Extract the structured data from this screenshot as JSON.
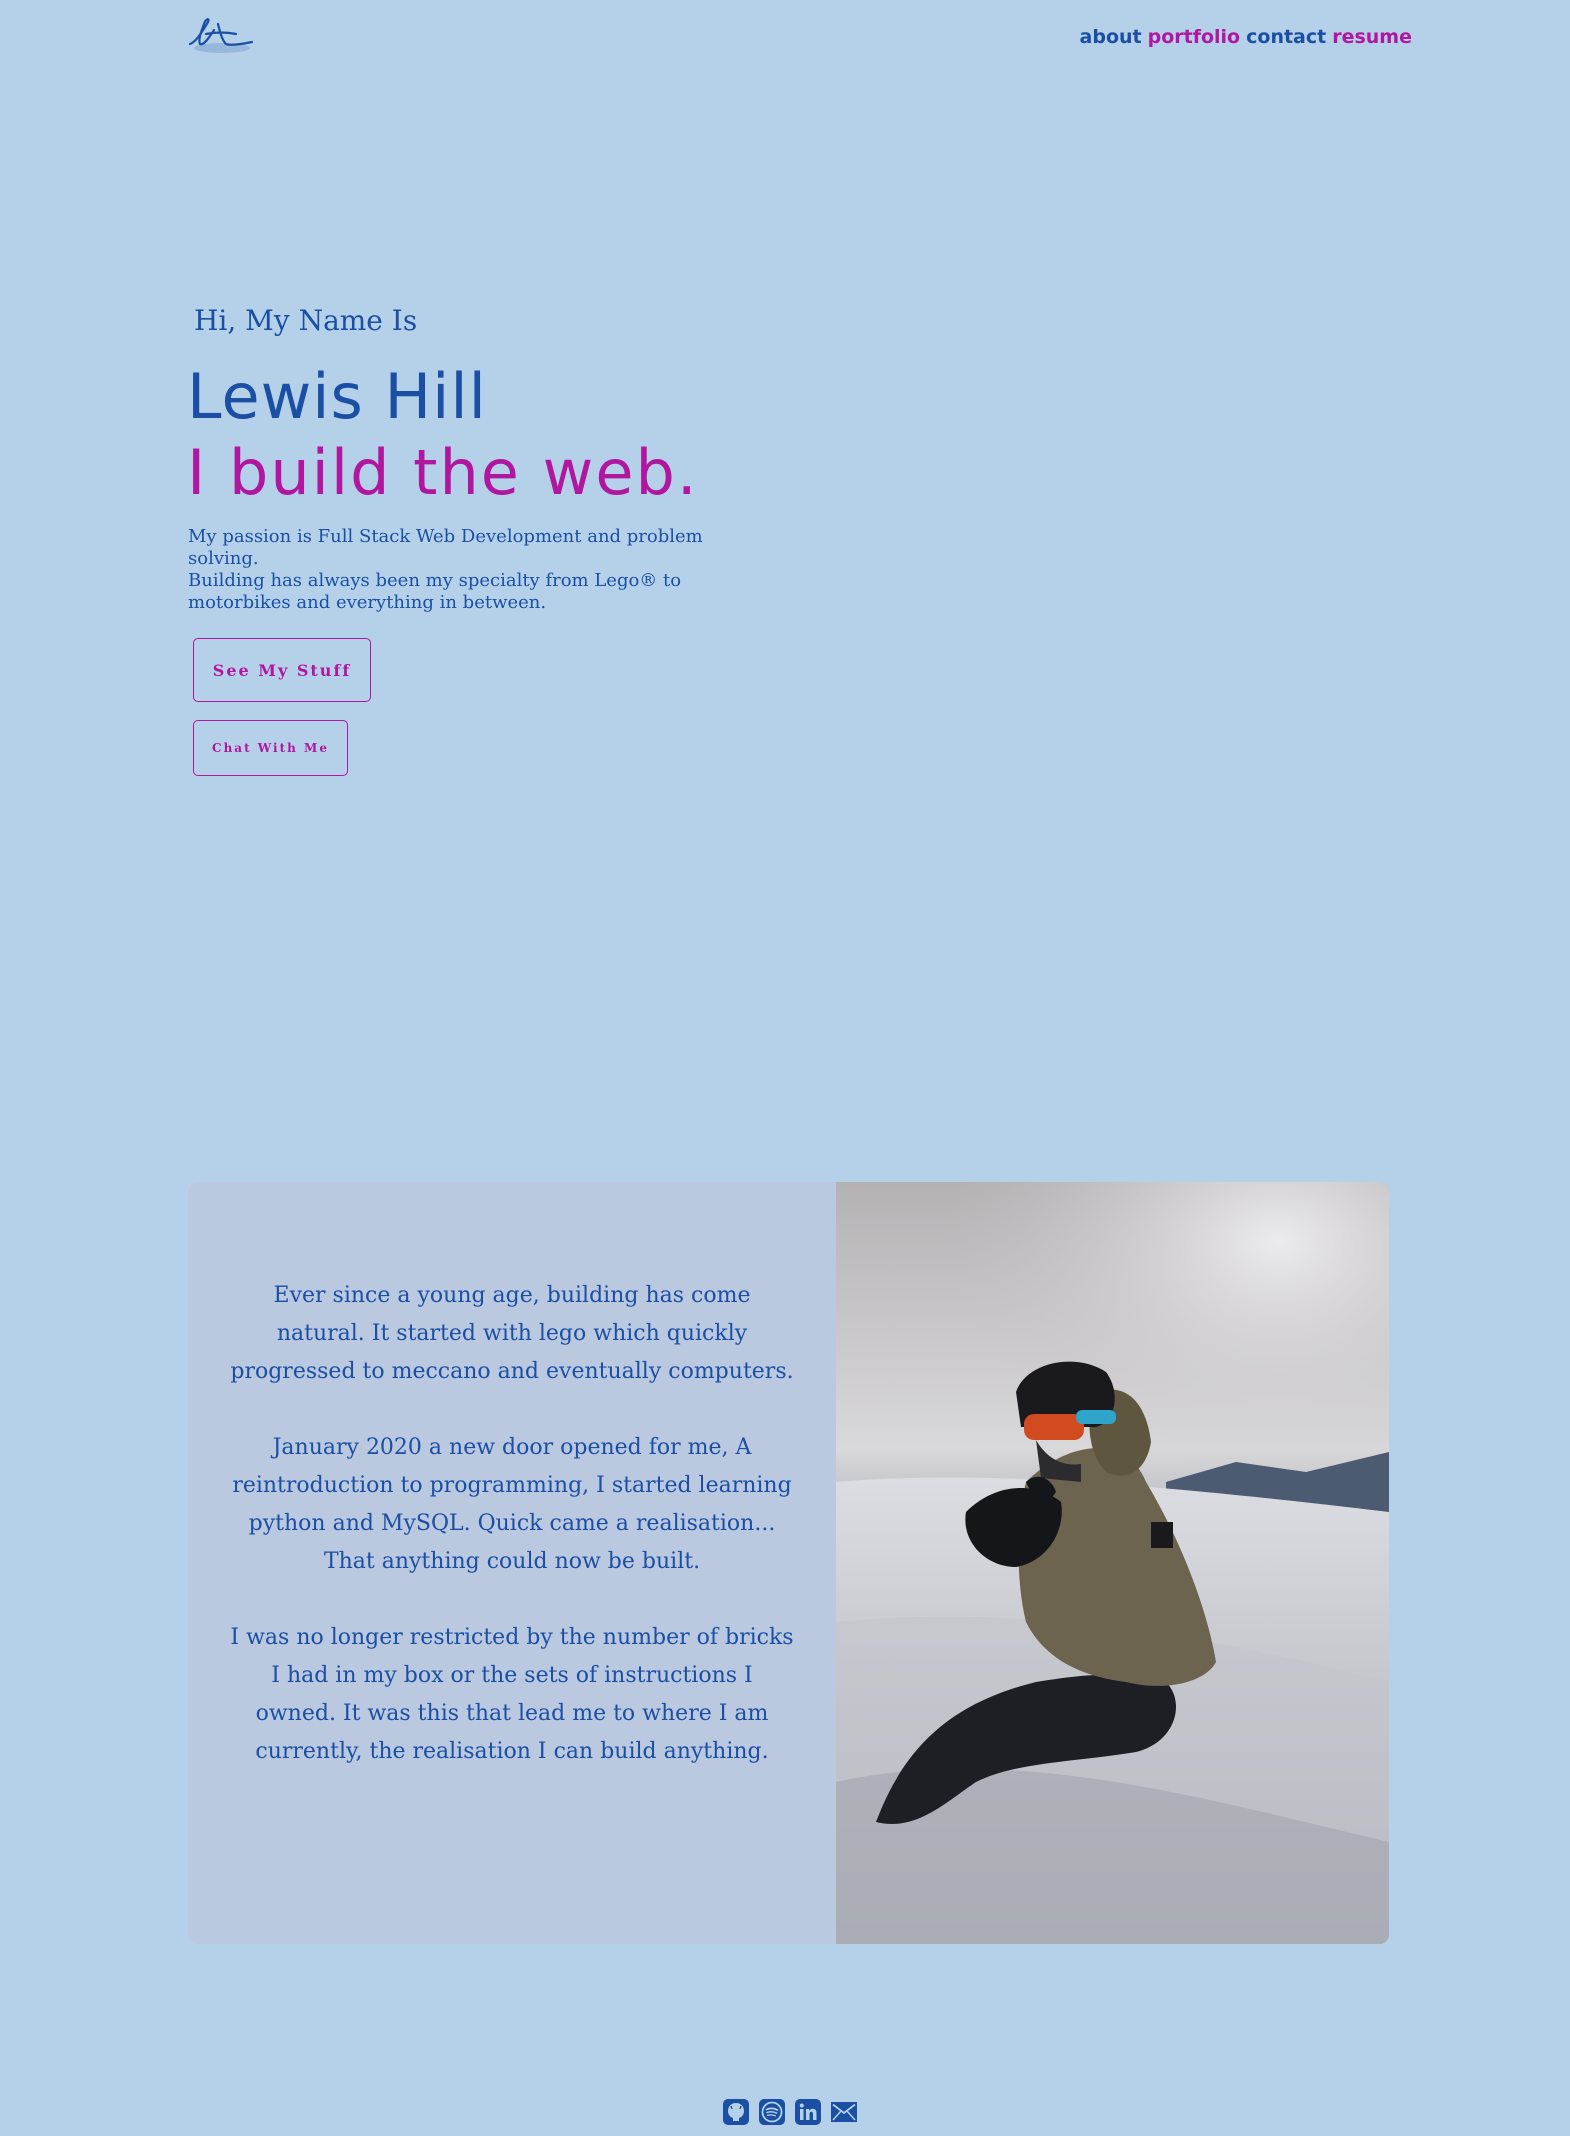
{
  "header": {
    "logo_icon": "signature-logo-icon",
    "nav": [
      {
        "label": "about",
        "color": "#1a4fa3"
      },
      {
        "label": "portfolio",
        "color": "#b0179e"
      },
      {
        "label": "contact",
        "color": "#1a4fa3"
      },
      {
        "label": "resume",
        "color": "#b0179e"
      }
    ]
  },
  "hero": {
    "greeting": "Hi, My Name Is",
    "name": "Lewis Hill",
    "tagline": "I build the web.",
    "intro_line1": "My passion is Full Stack Web Development and problem solving.",
    "intro_line2": "Building has always been my specialty from Lego® to motorbikes and everything in between.",
    "primary_button": "See My Stuff",
    "secondary_button": "Chat With Me"
  },
  "about": {
    "paragraphs": [
      "Ever since a young age, building has come natural. It started with lego which quickly progressed to meccano and eventually computers.",
      "January 2020 a new door opened for me, A reintroduction to programming, I started learning python and MySQL. Quick came a realisation... That anything could now be built.",
      "I was no longer restricted by the number of bricks I had in my box or the sets of instructions I owned. It was this that lead me to where I am currently, the realisation I can build anything."
    ],
    "photo_icon": "snowboarder-photo"
  },
  "footer": {
    "socials": [
      "github-icon",
      "spotify-icon",
      "linkedin-icon",
      "email-icon"
    ]
  },
  "colors": {
    "background": "#b5d1ea",
    "primary": "#1a4fa3",
    "accent": "#b0179e",
    "card": "#bac8e0"
  }
}
